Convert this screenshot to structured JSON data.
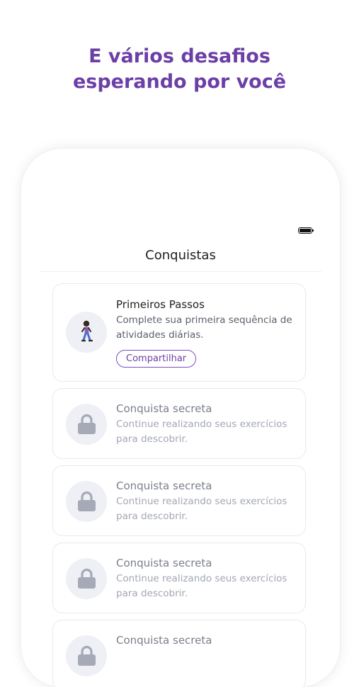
{
  "headline": {
    "line1": "E vários desafios",
    "line2": "esperando por você"
  },
  "screen": {
    "title": "Conquistas",
    "cards": [
      {
        "title": "Primeiros Passos",
        "desc": "Complete sua primeira sequência de atividades diárias.",
        "button": "Compartilhar",
        "icon": "walking-person-icon"
      },
      {
        "title": "Conquista secreta",
        "desc": "Continue realizando seus exercícios para descobrir.",
        "icon": "lock-icon"
      },
      {
        "title": "Conquista secreta",
        "desc": "Continue realizando seus exercícios para descobrir.",
        "icon": "lock-icon"
      },
      {
        "title": "Conquista secreta",
        "desc": "Continue realizando seus exercícios para descobrir.",
        "icon": "lock-icon"
      },
      {
        "title": "Conquista secreta",
        "icon": "lock-icon"
      }
    ]
  },
  "colors": {
    "accent": "#6b3fa6",
    "lock": "#a6aab6",
    "icon_bg": "#eef0f5"
  }
}
